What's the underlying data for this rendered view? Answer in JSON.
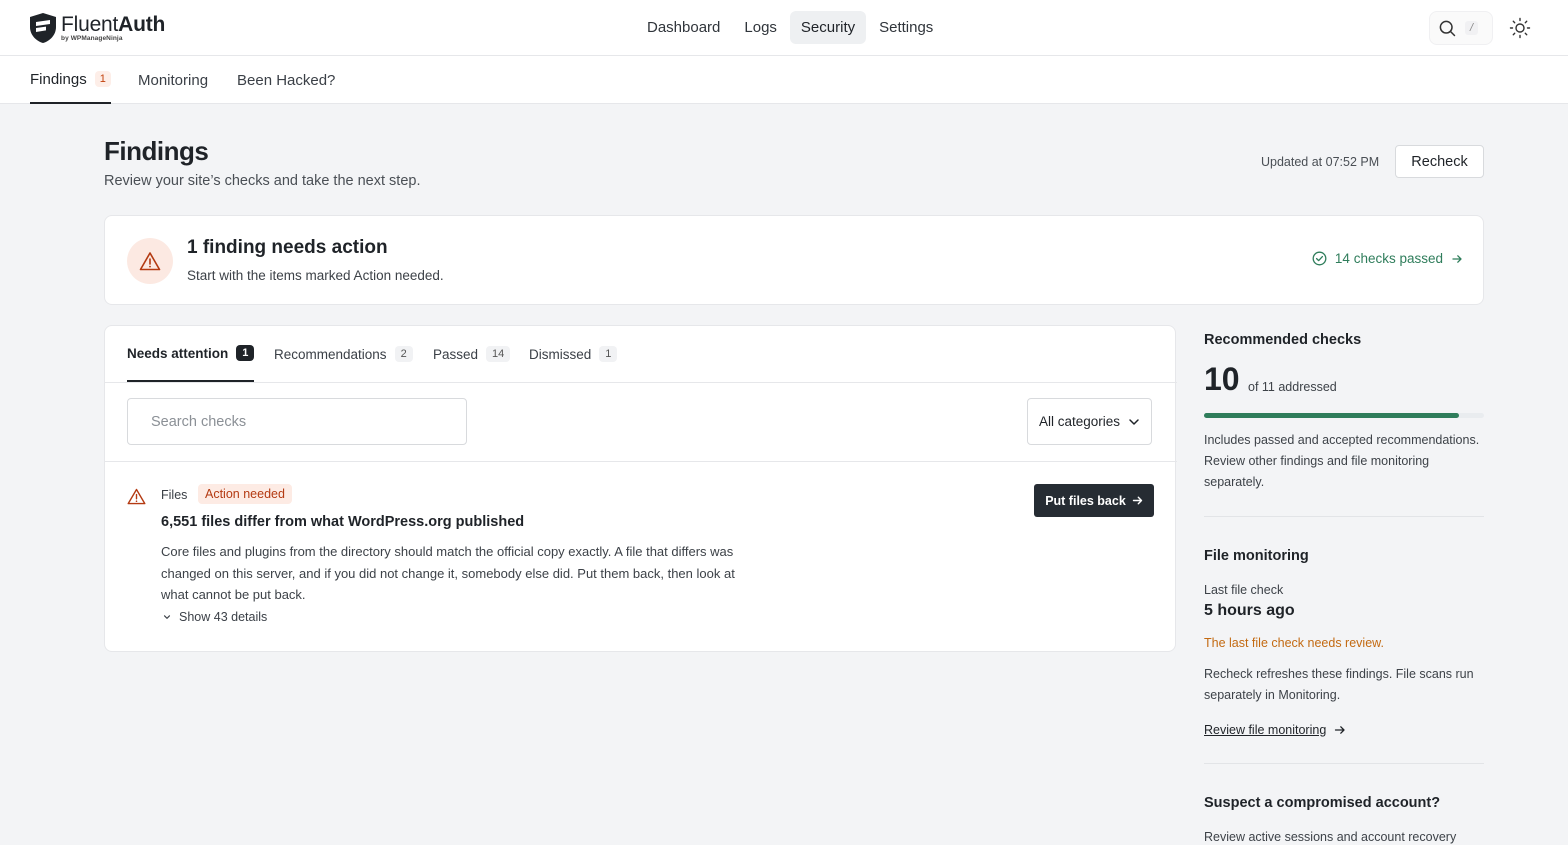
{
  "brand": {
    "name_light": "Fluent",
    "name_bold": "Auth",
    "by": "by WPManageNinja"
  },
  "nav": [
    {
      "label": "Dashboard"
    },
    {
      "label": "Logs"
    },
    {
      "label": "Security",
      "active": true
    },
    {
      "label": "Settings"
    }
  ],
  "search_shortcut": "/",
  "subnav": {
    "findings": "Findings",
    "findings_count": "1",
    "monitoring": "Monitoring",
    "hacked": "Been Hacked?"
  },
  "header": {
    "title": "Findings",
    "subtitle": "Review your site’s checks and take the next step.",
    "updated": "Updated at 07:52 PM",
    "recheck": "Recheck"
  },
  "summary": {
    "title": "1 finding needs action",
    "subtitle": "Start with the items marked Action needed.",
    "passed_link": "14 checks passed"
  },
  "tabs": [
    {
      "label": "Needs attention",
      "count": "1"
    },
    {
      "label": "Recommendations",
      "count": "2"
    },
    {
      "label": "Passed",
      "count": "14"
    },
    {
      "label": "Dismissed",
      "count": "1"
    }
  ],
  "filters": {
    "search_placeholder": "Search checks",
    "category": "All categories"
  },
  "finding": {
    "category": "Files",
    "badge": "Action needed",
    "title": "6,551 files differ from what WordPress.org published",
    "description": "Core files and plugins from the directory should match the official copy exactly. A file that differs was changed on this server, and if you did not change it, somebody else did. Put them back, then look at what cannot be put back.",
    "details_toggle": "Show 43 details",
    "action": "Put files back"
  },
  "sidebar": {
    "recommended": {
      "title": "Recommended checks",
      "value": "10",
      "of": "of 11 addressed",
      "progress_fraction": 0.91,
      "note": "Includes passed and accepted recommendations. Review other findings and file monitoring separately."
    },
    "file_monitoring": {
      "title": "File monitoring",
      "last_label": "Last file check",
      "last_value": "5 hours ago",
      "warning": "The last file check needs review.",
      "note": "Recheck refreshes these findings. File scans run separately in Monitoring.",
      "link": "Review file monitoring"
    },
    "compromised": {
      "title": "Suspect a compromised account?",
      "note": "Review active sessions and account recovery"
    }
  },
  "colors": {
    "accent_green": "#2f7d5b",
    "danger": "#b43a12",
    "warning": "#c36a12",
    "dark_button": "#262c33"
  }
}
